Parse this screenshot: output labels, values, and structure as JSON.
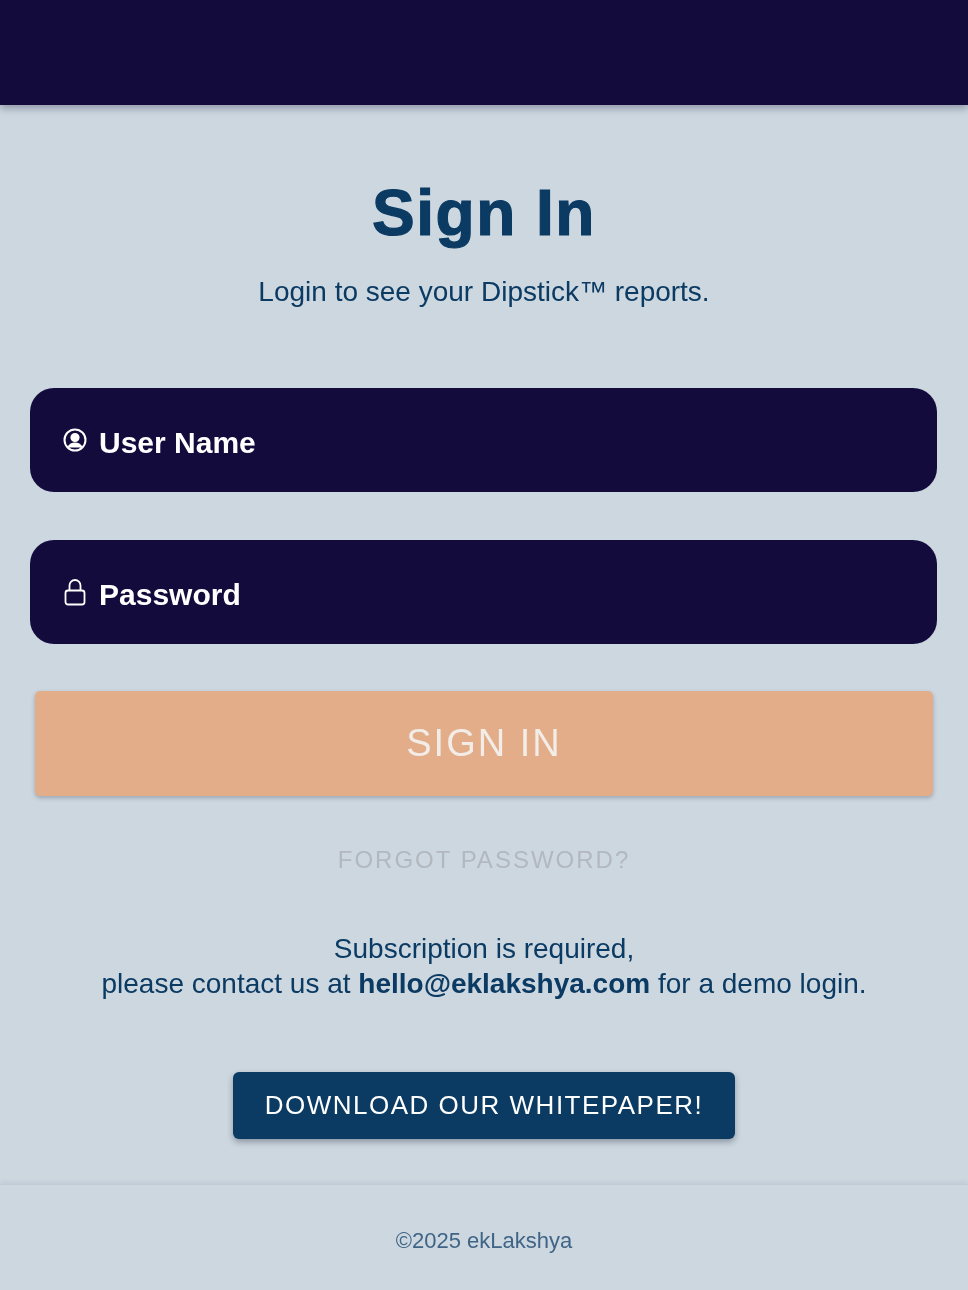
{
  "title": "Sign In",
  "subtitle": "Login to see your Dipstick™ reports.",
  "fields": [
    {
      "kind": "username",
      "placeholder": "User Name"
    },
    {
      "kind": "password",
      "placeholder": "Password"
    }
  ],
  "sign_in_button": "SIGN IN",
  "forgot_password_link": "FORGOT PASSWORD?",
  "notice": {
    "lines": [
      "Subscription is required,",
      "please contact us at **hello@eklakshya.com** for a demo login."
    ]
  },
  "whitepaper_button": "DOWNLOAD OUR WHITEPAPER!",
  "footer": {
    "text": "©2025 ekLakshya"
  }
}
